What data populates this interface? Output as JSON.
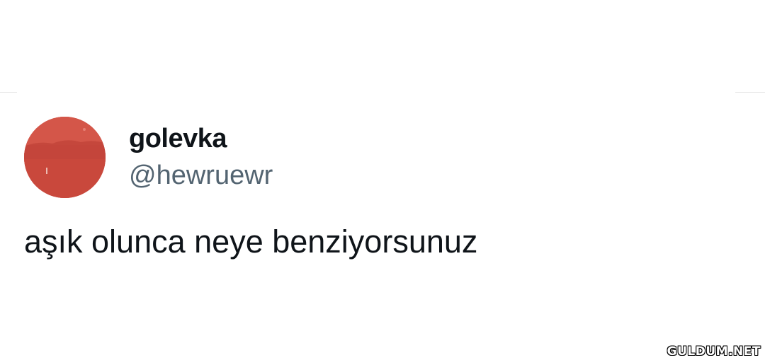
{
  "tweet": {
    "display_name": "golevka",
    "handle": "@hewruewr",
    "text": "aşık olunca neye benziyorsunuz",
    "avatar": {
      "icon": "profile-photo-red-landscape",
      "color": "#c9463a"
    }
  },
  "watermark": {
    "text": "GULDUM.NET"
  },
  "colors": {
    "primary_text": "#0f1419",
    "secondary_text": "#536471",
    "background": "#ffffff",
    "divider": "#e6e6e6"
  }
}
